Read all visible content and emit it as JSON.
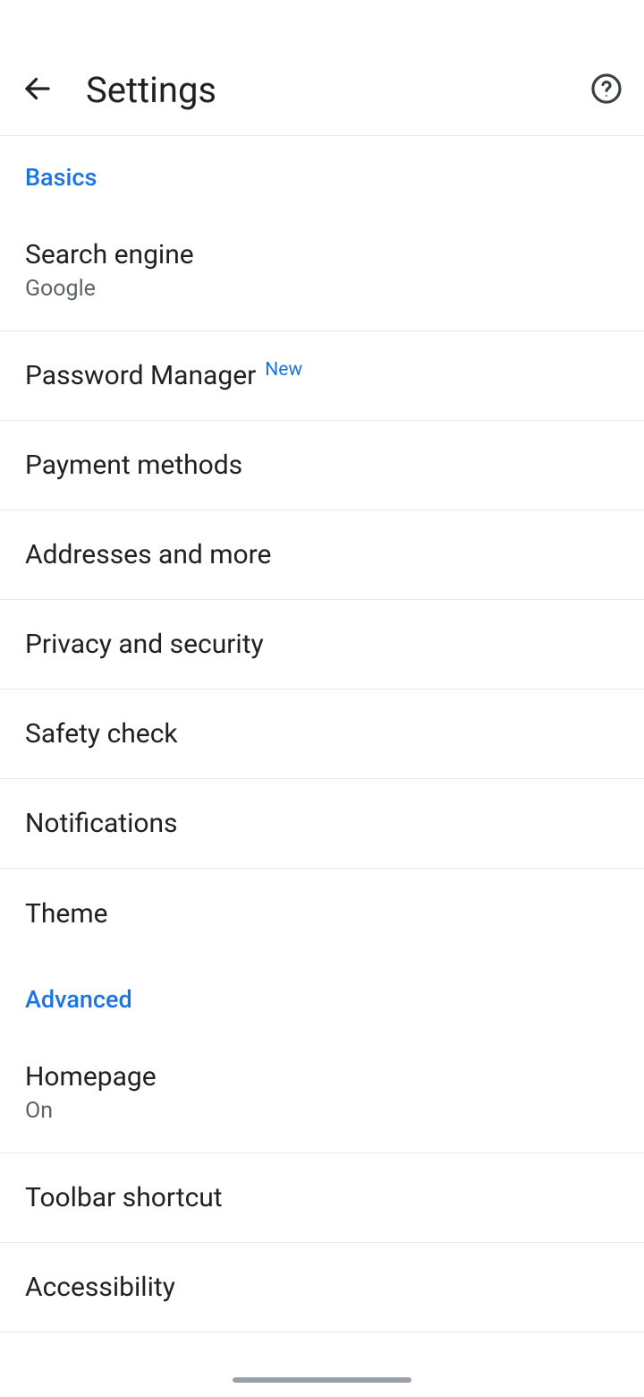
{
  "header": {
    "title": "Settings"
  },
  "sections": {
    "basics": {
      "label": "Basics",
      "items": {
        "search_engine": {
          "title": "Search engine",
          "subtitle": "Google"
        },
        "password_manager": {
          "title": "Password Manager",
          "badge": "New"
        },
        "payment_methods": {
          "title": "Payment methods"
        },
        "addresses": {
          "title": "Addresses and more"
        },
        "privacy": {
          "title": "Privacy and security"
        },
        "safety_check": {
          "title": "Safety check"
        },
        "notifications": {
          "title": "Notifications"
        },
        "theme": {
          "title": "Theme"
        }
      }
    },
    "advanced": {
      "label": "Advanced",
      "items": {
        "homepage": {
          "title": "Homepage",
          "subtitle": "On"
        },
        "toolbar_shortcut": {
          "title": "Toolbar shortcut"
        },
        "accessibility": {
          "title": "Accessibility"
        }
      }
    }
  }
}
